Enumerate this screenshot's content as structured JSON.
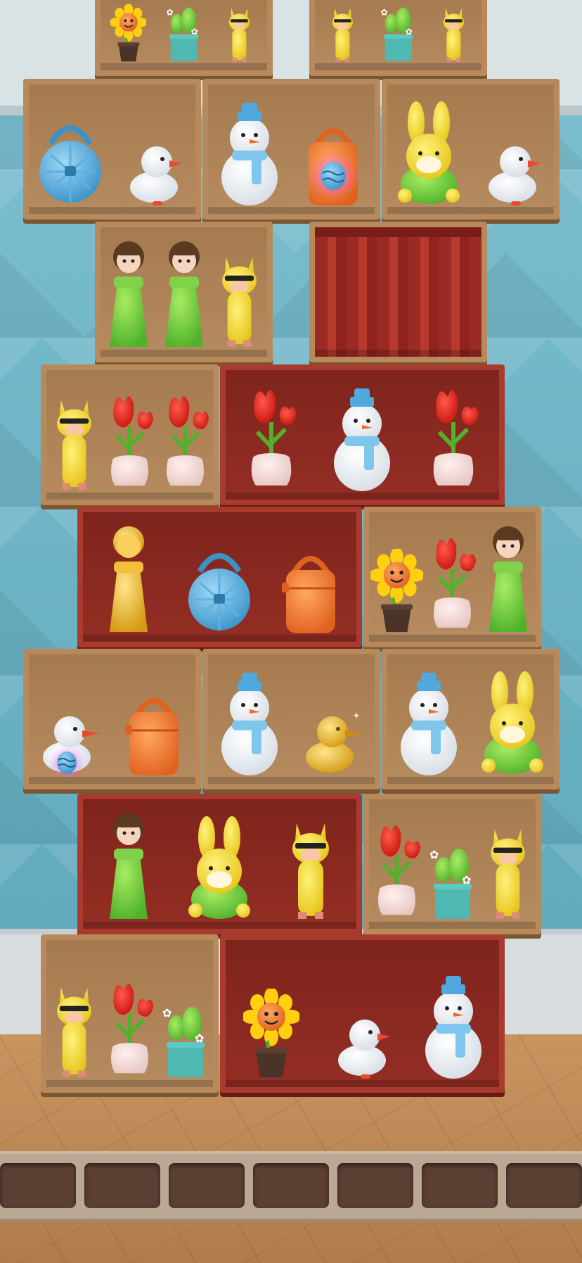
{
  "game": {
    "title": "",
    "colors": {
      "wood_shelf": "#b88a5b",
      "red_shelf": "#a93a2e",
      "wall": "#6fb0c2",
      "floor": "#c89561",
      "slot": "#5a3f32"
    }
  },
  "shelves": [
    {
      "id": "s-top-left",
      "style": "wood",
      "items": [
        "sunflower",
        "cactus",
        "llama"
      ]
    },
    {
      "id": "s-top-right",
      "style": "wood",
      "items": [
        "llama",
        "cactus",
        "llama"
      ]
    },
    {
      "id": "s-r1-a",
      "style": "wood",
      "items": [
        "blue-bag",
        "duck"
      ]
    },
    {
      "id": "s-r1-b",
      "style": "wood",
      "items": [
        "snowman",
        "orange-bag-glow"
      ]
    },
    {
      "id": "s-r1-c",
      "style": "wood",
      "items": [
        "bunny",
        "duck"
      ]
    },
    {
      "id": "s-r2-a",
      "style": "wood",
      "items": [
        "doll",
        "doll",
        "llama"
      ]
    },
    {
      "id": "s-r2-b",
      "style": "curtain",
      "items": []
    },
    {
      "id": "s-r3-a",
      "style": "wood",
      "items": [
        "llama",
        "tulip",
        "tulip"
      ]
    },
    {
      "id": "s-r3-b",
      "style": "red",
      "items": [
        "tulip",
        "snowman",
        "tulip"
      ]
    },
    {
      "id": "s-r4-a",
      "style": "red",
      "items": [
        "gold-doll",
        "blue-bag",
        "orange-bag"
      ]
    },
    {
      "id": "s-r4-b",
      "style": "wood",
      "items": [
        "sunflower",
        "tulip",
        "doll"
      ]
    },
    {
      "id": "s-r5-a",
      "style": "wood",
      "items": [
        "duck-glow",
        "orange-bag"
      ]
    },
    {
      "id": "s-r5-b",
      "style": "wood",
      "items": [
        "snowman",
        "gold-duck"
      ]
    },
    {
      "id": "s-r5-c",
      "style": "wood",
      "items": [
        "snowman",
        "bunny"
      ]
    },
    {
      "id": "s-r6-a",
      "style": "red",
      "items": [
        "doll",
        "bunny",
        "llama"
      ]
    },
    {
      "id": "s-r6-b",
      "style": "wood",
      "items": [
        "tulip",
        "cactus",
        "llama"
      ]
    },
    {
      "id": "s-r7-a",
      "style": "wood",
      "items": [
        "llama",
        "tulip",
        "cactus"
      ]
    },
    {
      "id": "s-r7-b",
      "style": "red",
      "items": [
        "sunflower",
        "duck",
        "snowman"
      ]
    }
  ],
  "tray": {
    "slot_count": 7,
    "filled": 0
  }
}
